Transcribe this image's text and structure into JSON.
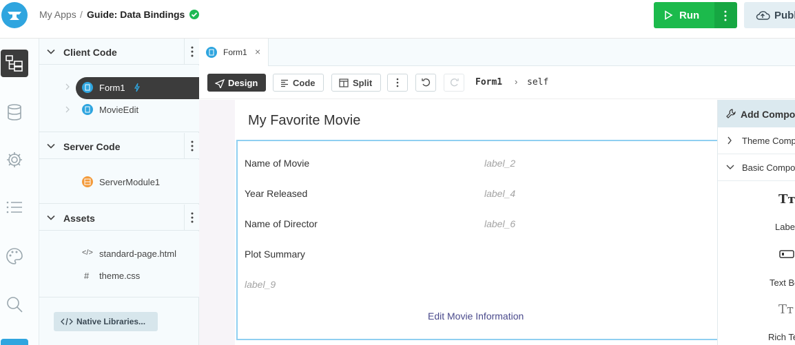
{
  "header": {
    "breadcrumb_root": "My Apps",
    "breadcrumb_sep": "/",
    "app_name": "Guide: Data Bindings",
    "run_label": "Run",
    "publish_label": "Publish"
  },
  "rail": {
    "items": [
      "app-browser-icon",
      "database-icon",
      "settings-icon",
      "list-icon",
      "palette-icon",
      "search-icon"
    ]
  },
  "explorer": {
    "client_code": {
      "title": "Client Code",
      "items": [
        {
          "label": "Form1",
          "selected": true
        },
        {
          "label": "MovieEdit"
        }
      ]
    },
    "server_code": {
      "title": "Server Code",
      "items": [
        {
          "label": "ServerModule1"
        }
      ]
    },
    "assets": {
      "title": "Assets",
      "items": [
        {
          "label": "standard-page.html",
          "icon": "</>"
        },
        {
          "label": "theme.css",
          "icon": "#"
        }
      ]
    },
    "native_libraries_label": "Native Libraries..."
  },
  "tabs": [
    {
      "label": "Form1",
      "close": "×"
    }
  ],
  "toolbar": {
    "design_label": "Design",
    "code_label": "Code",
    "split_label": "Split",
    "path_form": "Form1",
    "path_sep": "›",
    "path_self": "self"
  },
  "form": {
    "title": "My Favorite Movie",
    "fields": [
      {
        "label": "Name of Movie",
        "value": "label_2"
      },
      {
        "label": "Year Released",
        "value": "label_4"
      },
      {
        "label": "Name of Director",
        "value": "label_6"
      },
      {
        "label": "Plot Summary",
        "value": ""
      }
    ],
    "summary_value": "label_9",
    "edit_link": "Edit Movie Information"
  },
  "toolbox": {
    "title": "Add Components",
    "sections": [
      {
        "label": "Theme Components"
      },
      {
        "label": "Basic Components"
      }
    ],
    "components": [
      {
        "glyph": "Tт",
        "label": "Label"
      },
      {
        "glyph": "",
        "label": "Text Box"
      },
      {
        "glyph": "Tт",
        "label": "Rich Text"
      }
    ]
  },
  "colors": {
    "run_green": "#1cba4c",
    "accent_blue": "#2fa5df",
    "selected_dark": "#3c3c3c",
    "card_border": "#8fcff1"
  }
}
